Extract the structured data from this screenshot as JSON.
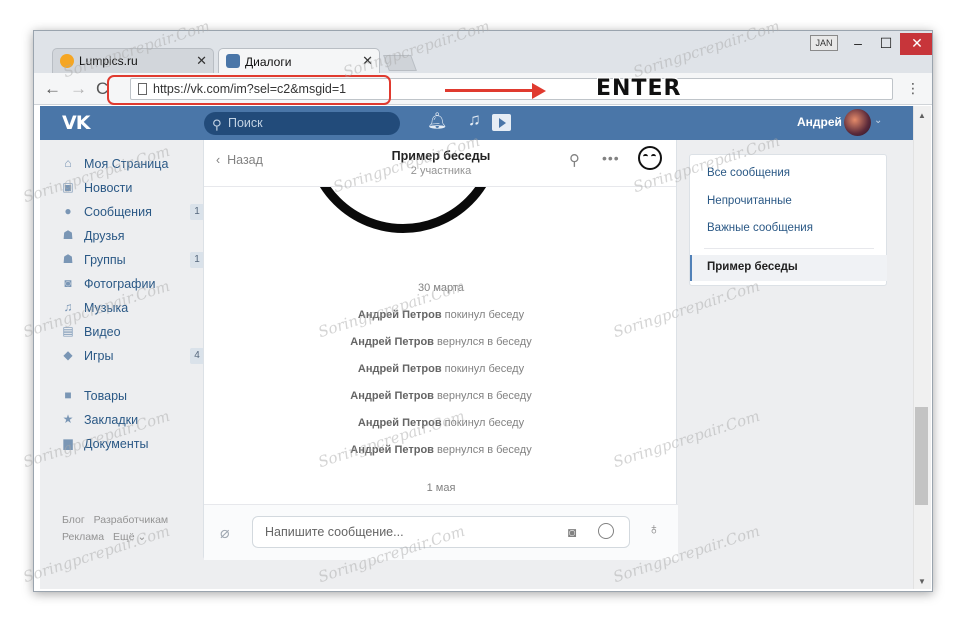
{
  "browser": {
    "tabs": [
      {
        "label": "Lumpics.ru",
        "icon": "lumpics-icon"
      },
      {
        "label": "Диалоги",
        "icon": "vk-dialog-icon"
      }
    ],
    "window_badge": "JAN",
    "url": "https://vk.com/im?sel=c2&msgid=1"
  },
  "annotation": {
    "label": "ENTER",
    "color": "#e03a2f"
  },
  "vk": {
    "logo": "VK",
    "search_placeholder": "Поиск",
    "user_name": "Андрей",
    "brand_color": "#4a76a8"
  },
  "leftnav": {
    "items": [
      {
        "label": "Моя Страница",
        "icon": "home-icon",
        "badge": ""
      },
      {
        "label": "Новости",
        "icon": "news-icon",
        "badge": ""
      },
      {
        "label": "Сообщения",
        "icon": "messages-icon",
        "badge": "1"
      },
      {
        "label": "Друзья",
        "icon": "friends-icon",
        "badge": ""
      },
      {
        "label": "Группы",
        "icon": "groups-icon",
        "badge": "1"
      },
      {
        "label": "Фотографии",
        "icon": "camera-icon",
        "badge": ""
      },
      {
        "label": "Музыка",
        "icon": "music-icon",
        "badge": ""
      },
      {
        "label": "Видео",
        "icon": "video-icon",
        "badge": ""
      },
      {
        "label": "Игры",
        "icon": "games-icon",
        "badge": "4"
      }
    ],
    "items2": [
      {
        "label": "Товары",
        "icon": "bag-icon"
      },
      {
        "label": "Закладки",
        "icon": "star-icon"
      },
      {
        "label": "Документы",
        "icon": "document-icon"
      }
    ],
    "footer_row1": [
      "Блог",
      "Разработчикам"
    ],
    "footer_row2": [
      "Реклама",
      "Ещё ⌄"
    ]
  },
  "chat": {
    "back_label": "Назад",
    "title": "Пример беседы",
    "subtitle": "2 участника",
    "date1": "30 марта",
    "system_messages": [
      {
        "name": "Андрей Петров",
        "action": "покинул беседу"
      },
      {
        "name": "Андрей Петров",
        "action": "вернулся в беседу"
      },
      {
        "name": "Андрей Петров",
        "action": "покинул беседу"
      },
      {
        "name": "Андрей Петров",
        "action": "вернулся в беседу"
      },
      {
        "name": "Андрей Петров",
        "action": "покинул беседу"
      },
      {
        "name": "Андрей Петров",
        "action": "вернулся в беседу"
      }
    ],
    "date2": "1 мая",
    "input_placeholder": "Напишите сообщение..."
  },
  "rightpanel": {
    "items": [
      "Все сообщения",
      "Непрочитанные",
      "Важные сообщения"
    ],
    "active": "Пример беседы"
  },
  "watermark": "Soringpcrepair.Com"
}
